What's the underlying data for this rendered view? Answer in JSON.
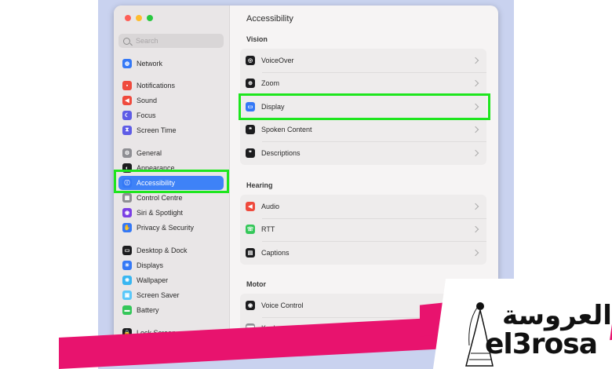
{
  "window": {
    "title": "Accessibility",
    "search_placeholder": "Search",
    "traffic_colors": [
      "#fe5f57",
      "#febc2e",
      "#28c840"
    ]
  },
  "sidebar": {
    "items": [
      {
        "label": "Network",
        "icon": "globe-icon",
        "color": "#3478f6",
        "glyph": "◍"
      },
      {
        "label": "Notifications",
        "icon": "bell-icon",
        "color": "#ef4a3d",
        "glyph": "▪"
      },
      {
        "label": "Sound",
        "icon": "speaker-icon",
        "color": "#ef4a3d",
        "glyph": "◀"
      },
      {
        "label": "Focus",
        "icon": "moon-icon",
        "color": "#5e5ce6",
        "glyph": "☾"
      },
      {
        "label": "Screen Time",
        "icon": "hourglass-icon",
        "color": "#5e5ce6",
        "glyph": "⧗"
      },
      {
        "label": "General",
        "icon": "gear-icon",
        "color": "#8e8e93",
        "glyph": "⚙"
      },
      {
        "label": "Appearance",
        "icon": "appearance-icon",
        "color": "#1c1c1e",
        "glyph": "◐"
      },
      {
        "label": "Accessibility",
        "icon": "accessibility-icon",
        "color": "#3478f6",
        "glyph": "ⓘ"
      },
      {
        "label": "Control Centre",
        "icon": "control-centre-icon",
        "color": "#8e8e93",
        "glyph": "▦"
      },
      {
        "label": "Siri & Spotlight",
        "icon": "siri-icon",
        "color": "#7b3fe4",
        "glyph": "◉"
      },
      {
        "label": "Privacy & Security",
        "icon": "hand-icon",
        "color": "#3478f6",
        "glyph": "✋"
      },
      {
        "label": "Desktop & Dock",
        "icon": "dock-icon",
        "color": "#1c1c1e",
        "glyph": "▭"
      },
      {
        "label": "Displays",
        "icon": "sun-icon",
        "color": "#3478f6",
        "glyph": "☀"
      },
      {
        "label": "Wallpaper",
        "icon": "wallpaper-icon",
        "color": "#38b6f1",
        "glyph": "❋"
      },
      {
        "label": "Screen Saver",
        "icon": "screen-saver-icon",
        "color": "#5ac8fa",
        "glyph": "▣"
      },
      {
        "label": "Battery",
        "icon": "battery-icon",
        "color": "#34c759",
        "glyph": "▬"
      },
      {
        "label": "Lock Screen",
        "icon": "lock-icon",
        "color": "#1c1c1e",
        "glyph": "🔒"
      }
    ]
  },
  "main": {
    "sections": [
      {
        "title": "Vision",
        "rows": [
          {
            "label": "VoiceOver",
            "icon": "voiceover-icon",
            "color": "#1c1c1e",
            "glyph": "◎"
          },
          {
            "label": "Zoom",
            "icon": "zoom-icon",
            "color": "#1c1c1e",
            "glyph": "⊕"
          },
          {
            "label": "Display",
            "icon": "display-icon",
            "color": "#3478f6",
            "glyph": "▭"
          },
          {
            "label": "Spoken Content",
            "icon": "spoken-content-icon",
            "color": "#1c1c1e",
            "glyph": "❝"
          },
          {
            "label": "Descriptions",
            "icon": "descriptions-icon",
            "color": "#1c1c1e",
            "glyph": "❞"
          }
        ]
      },
      {
        "title": "Hearing",
        "rows": [
          {
            "label": "Audio",
            "icon": "audio-icon",
            "color": "#ef4a3d",
            "glyph": "◀"
          },
          {
            "label": "RTT",
            "icon": "rtt-icon",
            "color": "#34c759",
            "glyph": "☏"
          },
          {
            "label": "Captions",
            "icon": "captions-icon",
            "color": "#1c1c1e",
            "glyph": "▤"
          }
        ]
      },
      {
        "title": "Motor",
        "rows": [
          {
            "label": "Voice Control",
            "icon": "voice-control-icon",
            "color": "#1c1c1e",
            "glyph": "◉"
          },
          {
            "label": "Keyboard",
            "icon": "keyboard-icon",
            "color": "#8e8e93",
            "glyph": "⌨"
          }
        ]
      }
    ]
  },
  "watermark": {
    "arabic": "العروسة",
    "latin": "el3rosa"
  }
}
